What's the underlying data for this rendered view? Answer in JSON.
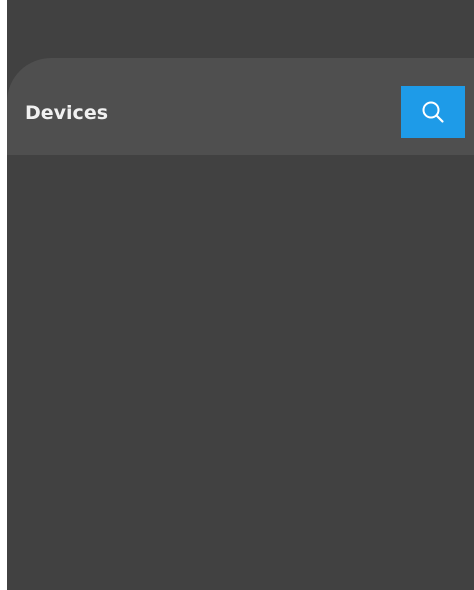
{
  "panel": {
    "title": "Devices",
    "search_button": {
      "icon": "search-icon",
      "color": "#1e9be8"
    }
  },
  "theme": {
    "background": "#414141",
    "header_background": "#4f4f4f",
    "accent": "#1e9be8"
  }
}
